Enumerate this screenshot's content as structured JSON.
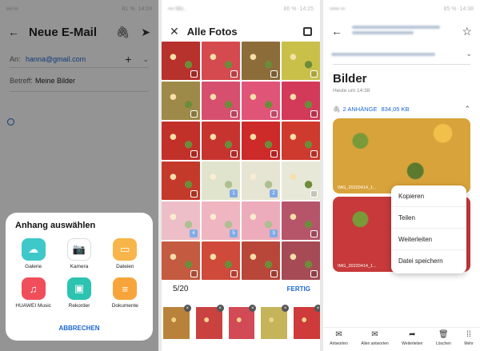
{
  "compose": {
    "status_time": "14:24",
    "status_battery": "81 %",
    "title": "Neue E-Mail",
    "to_label": "An:",
    "to_value": "hanna@gmail.com",
    "subject_label": "Betreff:",
    "subject_value": "Meine Bilder",
    "attach_sheet": {
      "title": "Anhang auswählen",
      "items": [
        {
          "label": "Galerie",
          "icon": "gallery-icon",
          "color": "#3ec8c9",
          "glyph": "☁"
        },
        {
          "label": "Kamera",
          "icon": "camera-icon",
          "color": "#ffffff",
          "glyph": "📷"
        },
        {
          "label": "Dateien",
          "icon": "files-icon",
          "color": "#f7b54a",
          "glyph": "▭"
        },
        {
          "label": "HUAWEI Music",
          "icon": "music-icon",
          "color": "#f04e5a",
          "glyph": "♫"
        },
        {
          "label": "Rekorder",
          "icon": "recorder-icon",
          "color": "#2cc3b0",
          "glyph": "▣"
        },
        {
          "label": "Dokumente",
          "icon": "documents-icon",
          "color": "#f7a53a",
          "glyph": "≡"
        }
      ],
      "cancel_label": "ABBRECHEN"
    }
  },
  "gallery": {
    "status_time": "14:25",
    "status_battery": "86 %",
    "title": "Alle Fotos",
    "photos": [
      {
        "c": "#b7312d"
      },
      {
        "c": "#d54a4f"
      },
      {
        "c": "#8c6d3a"
      },
      {
        "c": "#c9c04a"
      },
      {
        "c": "#9e8a48"
      },
      {
        "c": "#d64f6e"
      },
      {
        "c": "#e05478"
      },
      {
        "c": "#d33a5a"
      },
      {
        "c": "#c2302a"
      },
      {
        "c": "#c73430"
      },
      {
        "c": "#cd2a2a"
      },
      {
        "c": "#cf3a2e"
      },
      {
        "c": "#c43a2a",
        "n": ""
      },
      {
        "c": "#c9cfa6",
        "n": "1"
      },
      {
        "c": "#d3cfb0",
        "n": "2"
      },
      {
        "c": "#e7e8d8"
      },
      {
        "c": "#e08a9a",
        "n": "4"
      },
      {
        "c": "#e37a8e",
        "n": "5"
      },
      {
        "c": "#e06a84",
        "n": "3"
      },
      {
        "c": "#b6556a"
      },
      {
        "c": "#c45a40"
      },
      {
        "c": "#cf4a3a"
      },
      {
        "c": "#b8473a"
      },
      {
        "c": "#a64b55"
      }
    ],
    "count": "5/20",
    "done_label": "FERTIG",
    "thumbs": [
      {
        "c": "#b9823a"
      },
      {
        "c": "#c94240"
      },
      {
        "c": "#d14a55"
      },
      {
        "c": "#c5b45a"
      },
      {
        "c": "#cf3a3a"
      }
    ]
  },
  "mail": {
    "status_time": "14:38",
    "status_battery": "85 %",
    "title": "Bilder",
    "time": "Heute um 14:38",
    "attach_summary": "2 ANHÄNGE",
    "attach_size": "834,05 KB",
    "images": [
      {
        "caption": "IMG_20220414_1...",
        "c": "#d8a33a"
      },
      {
        "caption": "IMG_20220414_1...",
        "c": "#c7393a"
      }
    ],
    "menu": [
      "Kopieren",
      "Teilen",
      "Weiterleiten",
      "Datei speichern"
    ],
    "toolbar": [
      {
        "label": "Antworten",
        "icon": "reply-icon",
        "glyph": "✉"
      },
      {
        "label": "Allen antworten",
        "icon": "reply-all-icon",
        "glyph": "✉"
      },
      {
        "label": "Weiterleiten",
        "icon": "forward-icon",
        "glyph": "➦"
      },
      {
        "label": "Löschen",
        "icon": "delete-icon",
        "glyph": "🗑"
      },
      {
        "label": "Mehr",
        "icon": "more-icon",
        "glyph": "⁞⁞"
      }
    ]
  }
}
